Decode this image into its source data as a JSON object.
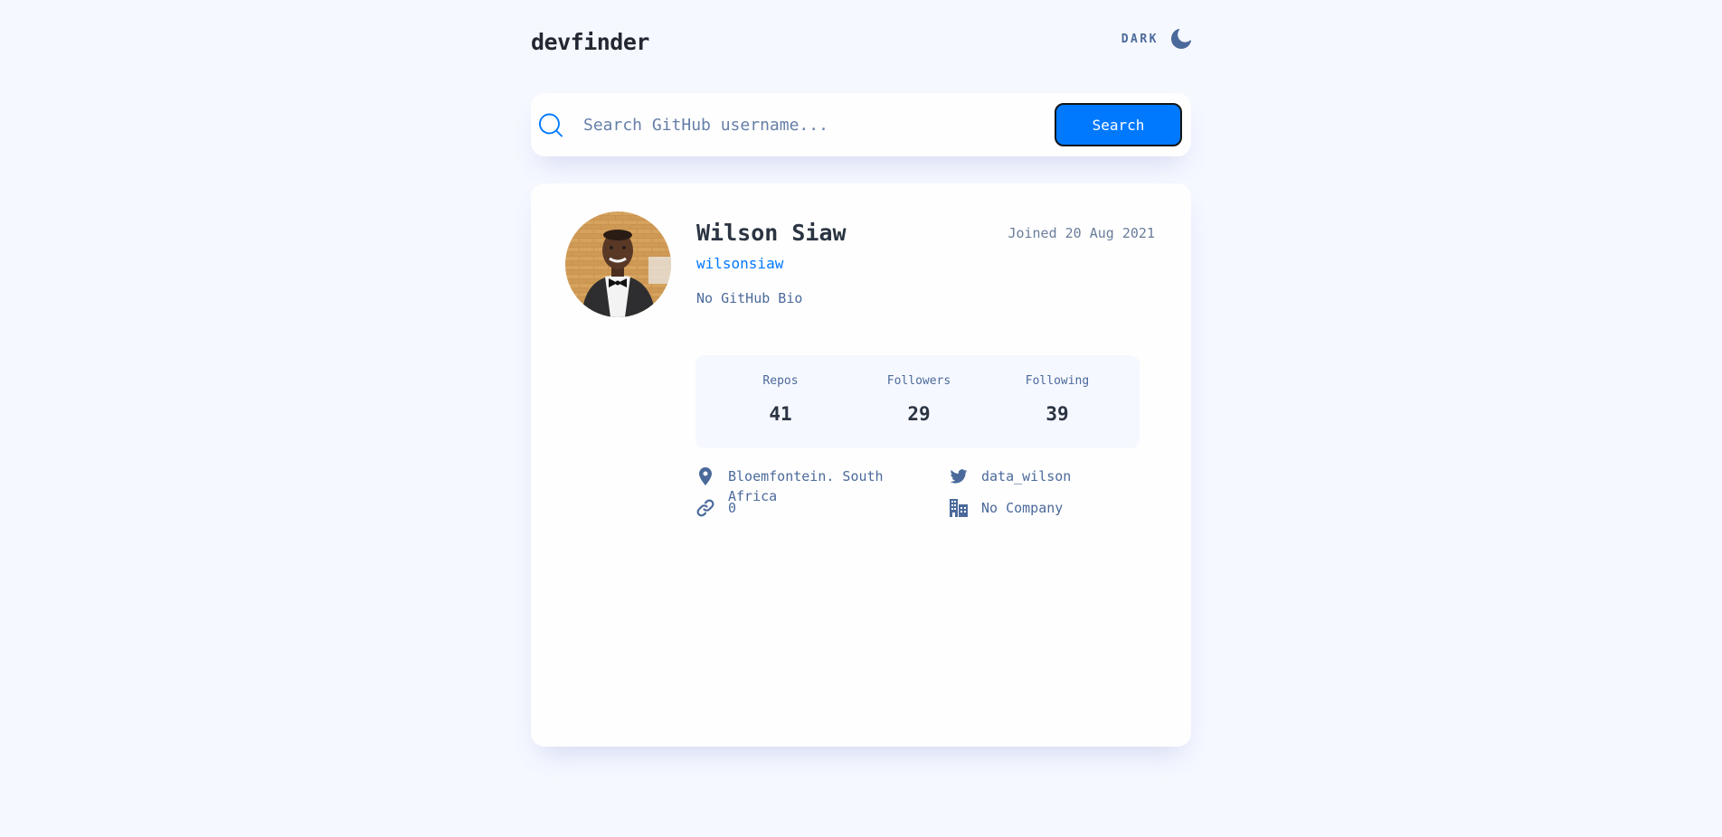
{
  "header": {
    "logo": "devfinder",
    "theme_label": "DARK",
    "theme_icon": "moon-icon"
  },
  "search": {
    "placeholder": "Search GitHub username...",
    "value": "",
    "button_label": "Search",
    "icon": "search-icon"
  },
  "profile": {
    "name": "Wilson Siaw",
    "login": "wilsonsiaw",
    "joined": "Joined 20 Aug 2021",
    "bio": "No GitHub Bio",
    "stats": [
      {
        "label": "Repos",
        "value": "41"
      },
      {
        "label": "Followers",
        "value": "29"
      },
      {
        "label": "Following",
        "value": "39"
      }
    ],
    "location": "Bloemfontein. South Africa",
    "twitter": "data_wilson",
    "blog": "0",
    "company": "No Company"
  },
  "colors": {
    "background": "#f6f8ff",
    "card": "#fefefe",
    "accent": "#0079ff",
    "text_muted": "#4b6a9b",
    "text_dark": "#2b3442"
  }
}
